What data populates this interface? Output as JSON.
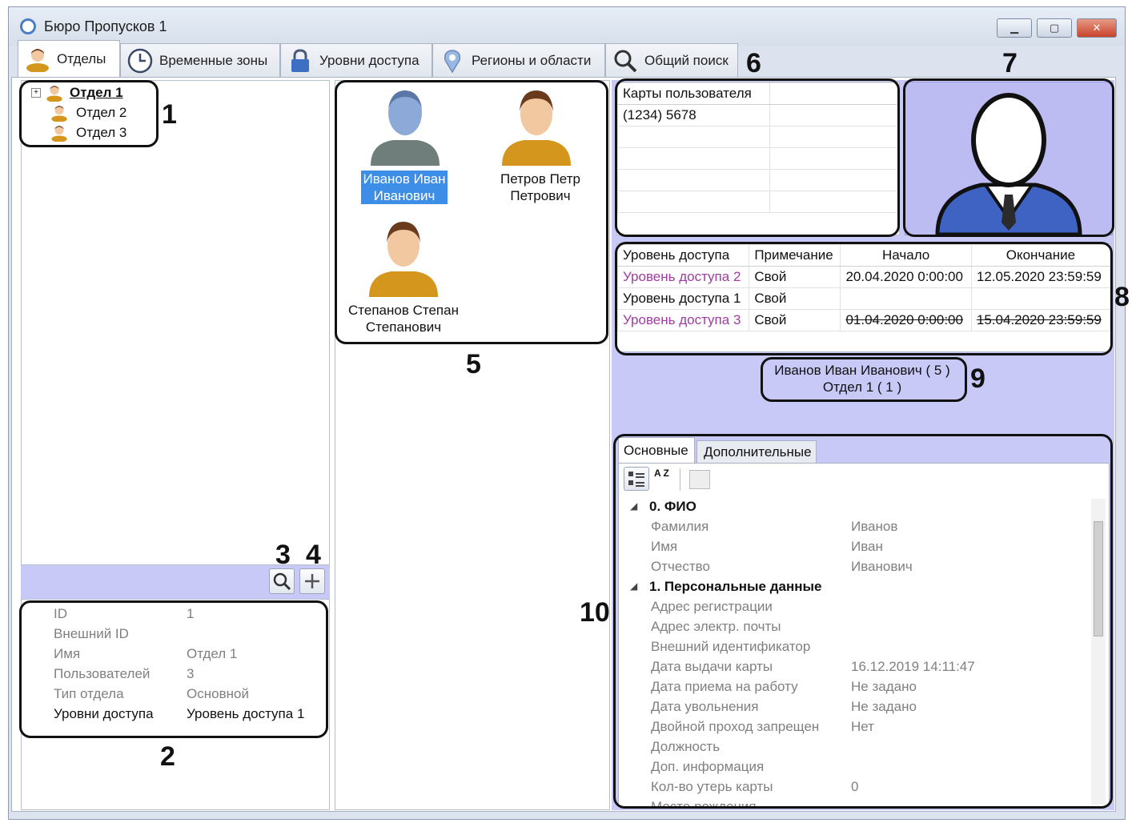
{
  "window": {
    "title": "Бюро Пропусков 1",
    "buttons": {
      "minimize": "▁",
      "maximize": "▢",
      "close": "✕"
    }
  },
  "tabs": [
    {
      "label": "Отделы",
      "icon": "person-icon",
      "active": true
    },
    {
      "label": "Временные зоны",
      "icon": "clock-icon"
    },
    {
      "label": "Уровни доступа",
      "icon": "lock-icon"
    },
    {
      "label": "Регионы и области",
      "icon": "map-pin-icon"
    },
    {
      "label": "Общий поиск",
      "icon": "search-icon"
    }
  ],
  "departments": {
    "items": [
      {
        "label": "Отдел 1",
        "selected": true
      },
      {
        "label": "Отдел 2"
      },
      {
        "label": "Отдел 3"
      }
    ]
  },
  "department_props": {
    "rows": [
      {
        "key": "ID",
        "value": "1"
      },
      {
        "key": "Внешний ID",
        "value": ""
      },
      {
        "key": "Имя",
        "value": "Отдел 1"
      },
      {
        "key": "Пользователей",
        "value": "3"
      },
      {
        "key": "Тип отдела",
        "value": "Основной"
      },
      {
        "key": "Уровни доступа",
        "value": "Уровень доступа 1"
      }
    ]
  },
  "employees": [
    {
      "name": "Иванов Иван Иванович",
      "line1": "Иванов Иван",
      "line2": "Иванович",
      "selected": true
    },
    {
      "name": "Петров Петр Петрович",
      "line1": "Петров Петр",
      "line2": "Петрович"
    },
    {
      "name": "Степанов Степан Степанович",
      "line1": "Степанов Степан",
      "line2": "Степанович"
    }
  ],
  "cards": {
    "header": "Карты пользователя",
    "rows": [
      "(1234) 5678"
    ]
  },
  "access_levels": {
    "headers": [
      "Уровень доступа",
      "Примечание",
      "Начало",
      "Окончание"
    ],
    "rows": [
      {
        "level": "Уровень доступа 2",
        "note": "Свой",
        "start": "20.04.2020 0:00:00",
        "end": "12.05.2020 23:59:59",
        "style": "purple"
      },
      {
        "level": "Уровень доступа 1",
        "note": "Свой",
        "start": "",
        "end": "",
        "style": "normal"
      },
      {
        "level": "Уровень доступа 3",
        "note": "Свой",
        "start": "01.04.2020 0:00:00",
        "end": "15.04.2020 23:59:59",
        "style": "expired"
      }
    ]
  },
  "summary": {
    "line1": "Иванов Иван Иванович ( 5 )",
    "line2": "Отдел 1 ( 1 )"
  },
  "properties": {
    "tabs": [
      "Основные",
      "Дополнительные"
    ],
    "toolbar": {
      "sort_az": "A Z"
    },
    "sections": [
      {
        "title": "0. ФИО",
        "rows": [
          {
            "key": "Фамилия",
            "value": "Иванов"
          },
          {
            "key": "Имя",
            "value": "Иван"
          },
          {
            "key": "Отчество",
            "value": "Иванович"
          }
        ]
      },
      {
        "title": "1. Персональные данные",
        "rows": [
          {
            "key": "Адрес регистрации",
            "value": ""
          },
          {
            "key": "Адрес электр. почты",
            "value": ""
          },
          {
            "key": "Внешний идентификатор",
            "value": ""
          },
          {
            "key": "Дата выдачи карты",
            "value": "16.12.2019 14:11:47"
          },
          {
            "key": "Дата приема на работу",
            "value": "Не задано"
          },
          {
            "key": "Дата увольнения",
            "value": "Не задано"
          },
          {
            "key": "Двойной проход запрещен",
            "value": "Нет"
          },
          {
            "key": "Должность",
            "value": ""
          },
          {
            "key": "Доп. информация",
            "value": ""
          },
          {
            "key": "Кол-во утерь карты",
            "value": "0"
          },
          {
            "key": "Место рождения",
            "value": ""
          }
        ]
      }
    ]
  },
  "callouts": [
    "1",
    "2",
    "3",
    "4",
    "5",
    "6",
    "7",
    "8",
    "9",
    "10"
  ],
  "colors": {
    "selection": "#3d8ee6",
    "lavender": "#c9c9f7",
    "purple_text": "#a23aa6",
    "orange_body": "#d4961c",
    "skin": "#f2c8a0",
    "hair": "#6a3a1c",
    "blue_person": "#8da9d8"
  }
}
